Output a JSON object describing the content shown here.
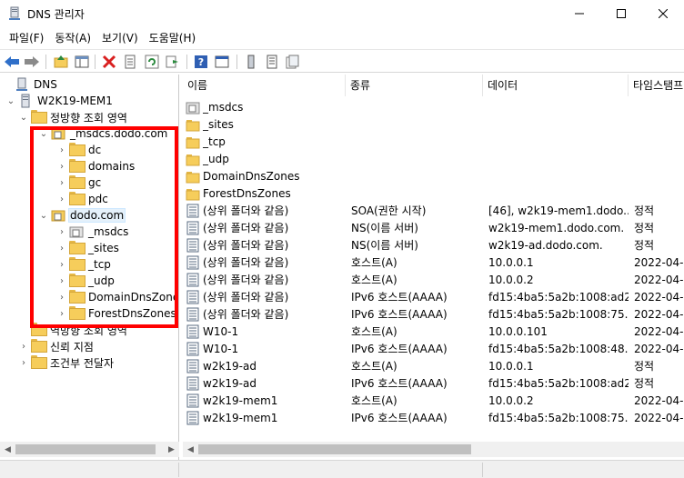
{
  "window": {
    "title": "DNS 관리자",
    "app_icon": "dns-manager-icon"
  },
  "menubar": [
    "파일(F)",
    "동작(A)",
    "보기(V)",
    "도움말(H)"
  ],
  "toolbar_icons": [
    "back-arrow-icon",
    "forward-arrow-icon",
    "up-folder-icon",
    "show-hide-tree-icon",
    "delete-icon",
    "properties-icon",
    "refresh-icon",
    "export-list-icon",
    "help-icon",
    "mmc-view-icon",
    "server-icon",
    "zone-list-icon",
    "zone-properties-icon"
  ],
  "tree": {
    "root": "DNS",
    "server": "W2K19-MEM1",
    "forward_zone": "정방향 조회 영역",
    "msdcs_zone": "_msdcs.dodo.com",
    "msdcs_children": [
      "dc",
      "domains",
      "gc",
      "pdc"
    ],
    "dodo_zone": "dodo.com",
    "dodo_children": [
      "_msdcs",
      "_sites",
      "_tcp",
      "_udp",
      "DomainDnsZones",
      "ForestDnsZones"
    ],
    "reverse_zone": "역방향 조회 영역",
    "trust_points": "신뢰 지점",
    "conditional_forwarders": "조건부 전달자"
  },
  "list": {
    "columns": [
      "이름",
      "종류",
      "데이터",
      "타임스탬프"
    ],
    "rows": [
      {
        "name": "_msdcs",
        "type": "",
        "data": "",
        "timestamp": "",
        "icon": "delegated-folder-icon"
      },
      {
        "name": "_sites",
        "type": "",
        "data": "",
        "timestamp": "",
        "icon": "folder-icon"
      },
      {
        "name": "_tcp",
        "type": "",
        "data": "",
        "timestamp": "",
        "icon": "folder-icon"
      },
      {
        "name": "_udp",
        "type": "",
        "data": "",
        "timestamp": "",
        "icon": "folder-icon"
      },
      {
        "name": "DomainDnsZones",
        "type": "",
        "data": "",
        "timestamp": "",
        "icon": "folder-icon"
      },
      {
        "name": "ForestDnsZones",
        "type": "",
        "data": "",
        "timestamp": "",
        "icon": "folder-icon"
      },
      {
        "name": "(상위 폴더와 같음)",
        "type": "SOA(권한 시작)",
        "data": "[46], w2k19-mem1.dodo....",
        "timestamp": "정적",
        "icon": "record-icon"
      },
      {
        "name": "(상위 폴더와 같음)",
        "type": "NS(이름 서버)",
        "data": "w2k19-mem1.dodo.com.",
        "timestamp": "정적",
        "icon": "record-icon"
      },
      {
        "name": "(상위 폴더와 같음)",
        "type": "NS(이름 서버)",
        "data": "w2k19-ad.dodo.com.",
        "timestamp": "정적",
        "icon": "record-icon"
      },
      {
        "name": "(상위 폴더와 같음)",
        "type": "호스트(A)",
        "data": "10.0.0.1",
        "timestamp": "2022-04-",
        "icon": "record-icon"
      },
      {
        "name": "(상위 폴더와 같음)",
        "type": "호스트(A)",
        "data": "10.0.0.2",
        "timestamp": "2022-04-",
        "icon": "record-icon"
      },
      {
        "name": "(상위 폴더와 같음)",
        "type": "IPv6 호스트(AAAA)",
        "data": "fd15:4ba5:5a2b:1008:ad2...",
        "timestamp": "2022-04-",
        "icon": "record-icon"
      },
      {
        "name": "(상위 폴더와 같음)",
        "type": "IPv6 호스트(AAAA)",
        "data": "fd15:4ba5:5a2b:1008:75...",
        "timestamp": "2022-04-",
        "icon": "record-icon"
      },
      {
        "name": "W10-1",
        "type": "호스트(A)",
        "data": "10.0.0.101",
        "timestamp": "2022-04-",
        "icon": "record-icon"
      },
      {
        "name": "W10-1",
        "type": "IPv6 호스트(AAAA)",
        "data": "fd15:4ba5:5a2b:1008:48...",
        "timestamp": "2022-04-",
        "icon": "record-icon"
      },
      {
        "name": "w2k19-ad",
        "type": "호스트(A)",
        "data": "10.0.0.1",
        "timestamp": "정적",
        "icon": "record-icon"
      },
      {
        "name": "w2k19-ad",
        "type": "IPv6 호스트(AAAA)",
        "data": "fd15:4ba5:5a2b:1008:ad2...",
        "timestamp": "정적",
        "icon": "record-icon"
      },
      {
        "name": "w2k19-mem1",
        "type": "호스트(A)",
        "data": "10.0.0.2",
        "timestamp": "2022-04-",
        "icon": "record-icon"
      },
      {
        "name": "w2k19-mem1",
        "type": "IPv6 호스트(AAAA)",
        "data": "fd15:4ba5:5a2b:1008:75...",
        "timestamp": "2022-04-",
        "icon": "record-icon"
      }
    ]
  },
  "colors": {
    "annotation": "#ff0000",
    "selection": "#e5f1fb",
    "folder": "#f6cd5b"
  }
}
